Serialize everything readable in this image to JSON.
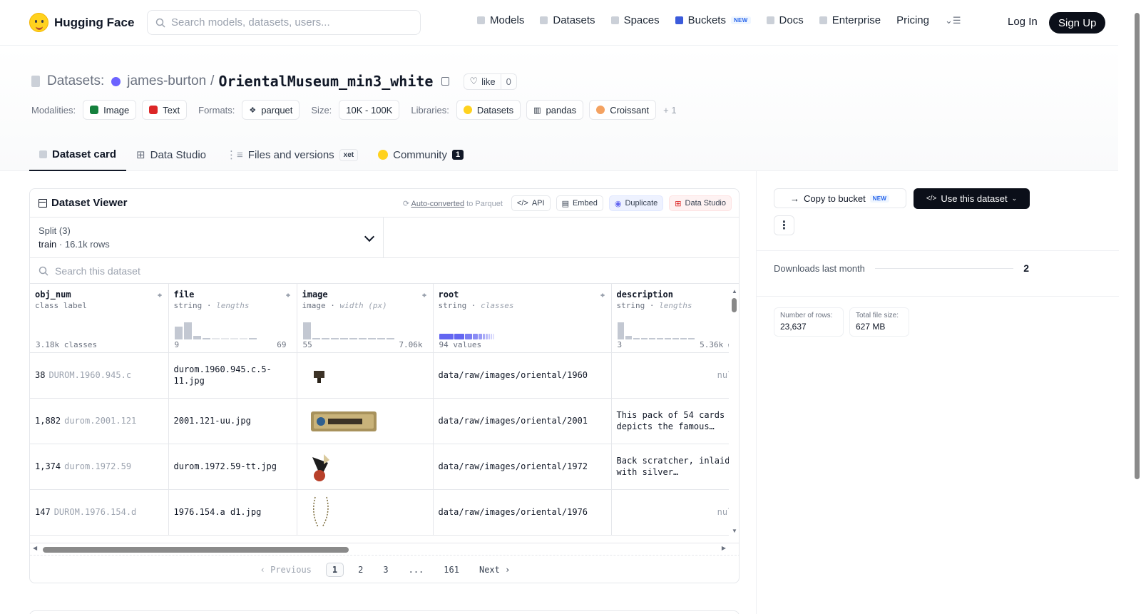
{
  "nav": {
    "brand": "Hugging Face",
    "search_placeholder": "Search models, datasets, users...",
    "links": [
      "Models",
      "Datasets",
      "Spaces",
      "Buckets",
      "Docs",
      "Enterprise",
      "Pricing"
    ],
    "new_badge": "NEW",
    "login": "Log In",
    "signup": "Sign Up"
  },
  "header": {
    "prefix": "Datasets:",
    "owner": "james-burton",
    "separator": "/",
    "name": "OrientalMuseum_min3_white",
    "like_label": "like",
    "like_count": "0",
    "modalities_label": "Modalities:",
    "modalities": [
      "Image",
      "Text"
    ],
    "formats_label": "Formats:",
    "format": "parquet",
    "size_label": "Size:",
    "size": "10K - 100K",
    "libraries_label": "Libraries:",
    "libraries": [
      "Datasets",
      "pandas",
      "Croissant"
    ],
    "libraries_more": "+ 1"
  },
  "tabs": {
    "card": "Dataset card",
    "studio": "Data Studio",
    "files": "Files and versions",
    "xet": "xet",
    "community": "Community",
    "community_count": "1"
  },
  "viewer": {
    "title": "Dataset Viewer",
    "auto_link": "Auto-converted",
    "auto_rest": "to Parquet",
    "api": "API",
    "embed": "Embed",
    "duplicate": "Duplicate",
    "data_studio": "Data Studio",
    "split_label": "Split (3)",
    "split_name": "train",
    "split_rows": "16.1k rows",
    "search_placeholder": "Search this dataset",
    "columns": [
      {
        "name": "obj_num",
        "type": "class label",
        "stat": "",
        "range_min": "3.18k classes",
        "range_max": ""
      },
      {
        "name": "file",
        "type": "string",
        "stat": "lengths",
        "range_min": "9",
        "range_max": "69"
      },
      {
        "name": "image",
        "type": "image",
        "stat": "width (px)",
        "range_min": "55",
        "range_max": "7.06k"
      },
      {
        "name": "root",
        "type": "string",
        "stat": "classes",
        "range_min": "94 values",
        "range_max": ""
      },
      {
        "name": "description",
        "type": "string",
        "stat": "lengths",
        "range_min": "3",
        "range_max": "5.36k ⌀"
      }
    ],
    "rows": [
      {
        "obj_num": "38",
        "obj_sub": "DUROM.1960.945.c",
        "file": "durom.1960.945.c.5-11.jpg",
        "root": "data/raw/images/oriental/1960",
        "description": "null"
      },
      {
        "obj_num": "1,882",
        "obj_sub": "durom.2001.121",
        "file": "2001.121-uu.jpg",
        "root": "data/raw/images/oriental/2001",
        "description": "This pack of 54 cards depicts the famous…"
      },
      {
        "obj_num": "1,374",
        "obj_sub": "durom.1972.59",
        "file": "durom.1972.59-tt.jpg",
        "root": "data/raw/images/oriental/1972",
        "description": "Back scratcher, inlaid with silver…"
      },
      {
        "obj_num": "147",
        "obj_sub": "DUROM.1976.154.d",
        "file": "1976.154.a d1.jpg",
        "root": "data/raw/images/oriental/1976",
        "description": "null"
      }
    ],
    "pager": {
      "prev": "Previous",
      "pages": [
        "1",
        "2",
        "3",
        "...",
        "161"
      ],
      "next": "Next"
    }
  },
  "side": {
    "copy_bucket": "Copy to bucket",
    "new_badge": "NEW",
    "use_dataset": "Use this dataset",
    "downloads_label": "Downloads last month",
    "downloads": "2",
    "rows_label": "Number of rows:",
    "rows_value": "23,637",
    "size_label": "Total file size:",
    "size_value": "627 MB"
  },
  "colors": {
    "accent": "#6366f1",
    "primary_button": "#0b0f19",
    "brand_yellow": "#ffd21e"
  }
}
